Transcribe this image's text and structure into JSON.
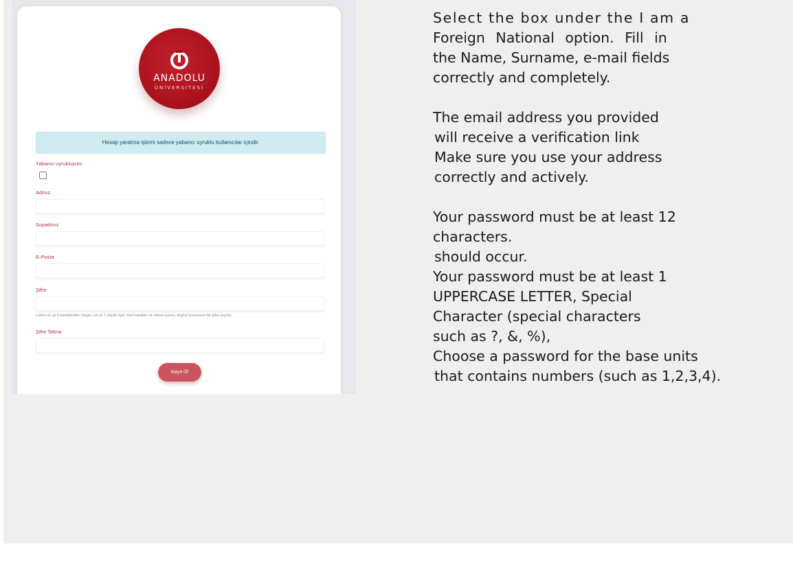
{
  "form": {
    "logo": {
      "name": "ANADOLU",
      "subtitle": "ÜNİVERSİTESİ",
      "brand_color": "#a8111c"
    },
    "alert_text": "Hesap yaratma işlemi sadece yabancı uyruklu kullanıcılar içindir.",
    "foreign_label": "Yabancı uyrukluyum",
    "foreign_checked": false,
    "name_label": "Adınız",
    "surname_label": "Soyadınız",
    "email_label": "E-Posta",
    "password_label": "Şifre",
    "password_hint": "Lütfen en az 8 karakterden oluşan, en az 1 büyük harf, özel karakter ve rakam içeren, boşluk içermeyen bir şifre seçiniz.",
    "password_repeat_label": "Şifre Tekrar",
    "submit_label": "Kayıt Ol",
    "accent_color": "#c9555f"
  },
  "instructions": {
    "p1": [
      "Select the box under the I am a",
      "Foreign National option. Fill in",
      "the Name, Surname, e-mail fields",
      "correctly and completely."
    ],
    "p2": [
      "The email address you provided",
      "will receive a verification link",
      "Make sure you use your address",
      "correctly and actively."
    ],
    "p3": [
      "Your password must be at least 12",
      "characters.",
      "should occur.",
      "Your password must be at least 1",
      "UPPERCASE LETTER, Special",
      "Character (special characters",
      "such as ?, &, %),",
      "Choose a password for the base units",
      "that contains numbers (such as 1,2,3,4)."
    ]
  }
}
